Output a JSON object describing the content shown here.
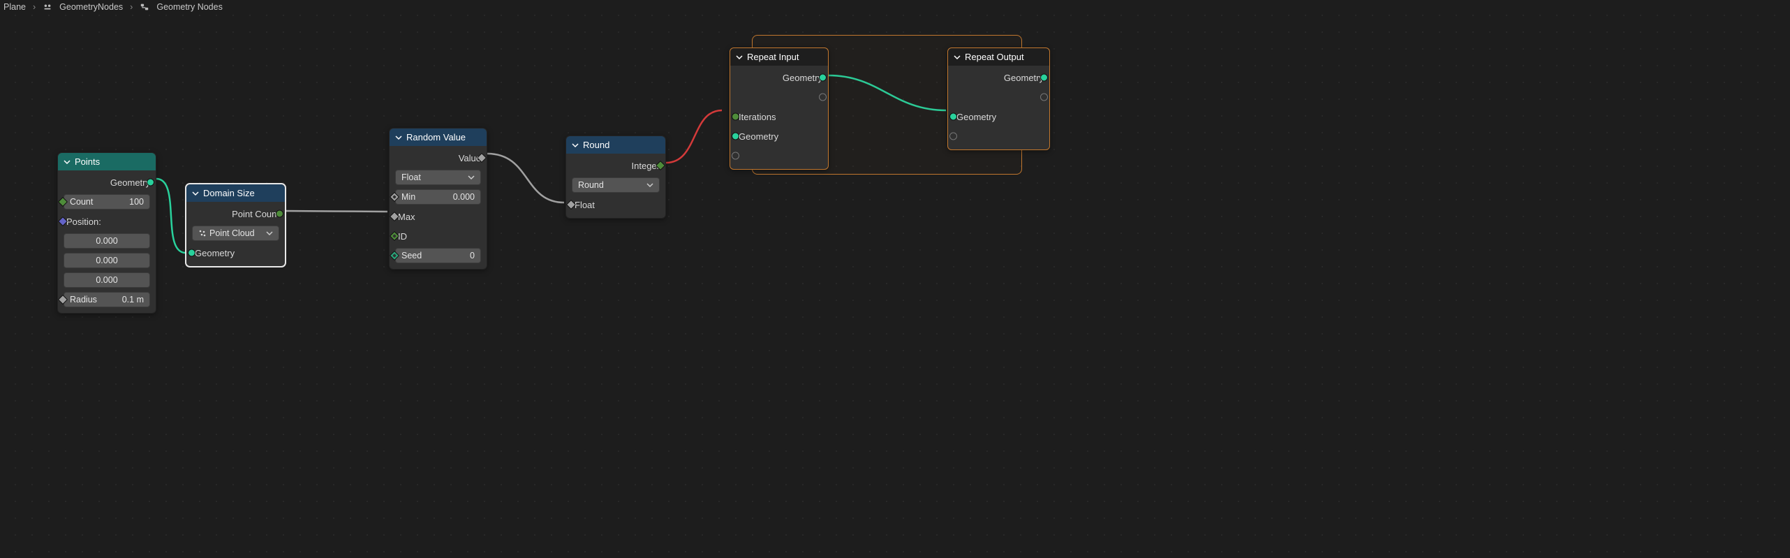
{
  "breadcrumb": {
    "item1": "Plane",
    "item2": "GeometryNodes",
    "item3": "Geometry Nodes"
  },
  "nodes": {
    "points": {
      "title": "Points",
      "out_geometry": "Geometry",
      "count_label": "Count",
      "count_value": "100",
      "position_label": "Position:",
      "pos_x": "0.000",
      "pos_y": "0.000",
      "pos_z": "0.000",
      "radius_label": "Radius",
      "radius_value": "0.1 m"
    },
    "domain_size": {
      "title": "Domain Size",
      "out_point_count": "Point Count",
      "mode": "Point Cloud",
      "in_geometry": "Geometry"
    },
    "random_value": {
      "title": "Random Value",
      "out_value": "Value",
      "type": "Float",
      "min_label": "Min",
      "min_value": "0.000",
      "max_label": "Max",
      "id_label": "ID",
      "seed_label": "Seed",
      "seed_value": "0"
    },
    "round": {
      "title": "Round",
      "out_integer": "Integer",
      "mode": "Round",
      "in_float": "Float"
    },
    "repeat_in": {
      "title": "Repeat Input",
      "out_geometry": "Geometry",
      "iterations": "Iterations",
      "in_geometry": "Geometry"
    },
    "repeat_out": {
      "title": "Repeat Output",
      "out_geometry": "Geometry",
      "in_geometry": "Geometry"
    }
  }
}
